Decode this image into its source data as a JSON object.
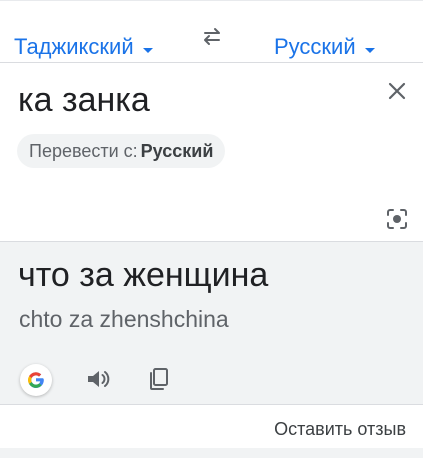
{
  "languages": {
    "source": "Таджикский",
    "target": "Русский",
    "swap_icon": "swap-arrows-icon",
    "accent_color": "#1a73e8"
  },
  "input": {
    "text": "ка занка",
    "detect_prefix": "Перевести с:",
    "detect_language": "Русский",
    "clear_icon": "close-icon",
    "camera_icon": "camera-lens-icon"
  },
  "output": {
    "translation": "что за женщина",
    "transliteration": "chto za zhenshchina",
    "actions": [
      "google-icon",
      "speaker-icon",
      "copy-icon"
    ],
    "background": "#f1f3f4"
  },
  "footer": {
    "feedback_label": "Оставить отзыв"
  }
}
